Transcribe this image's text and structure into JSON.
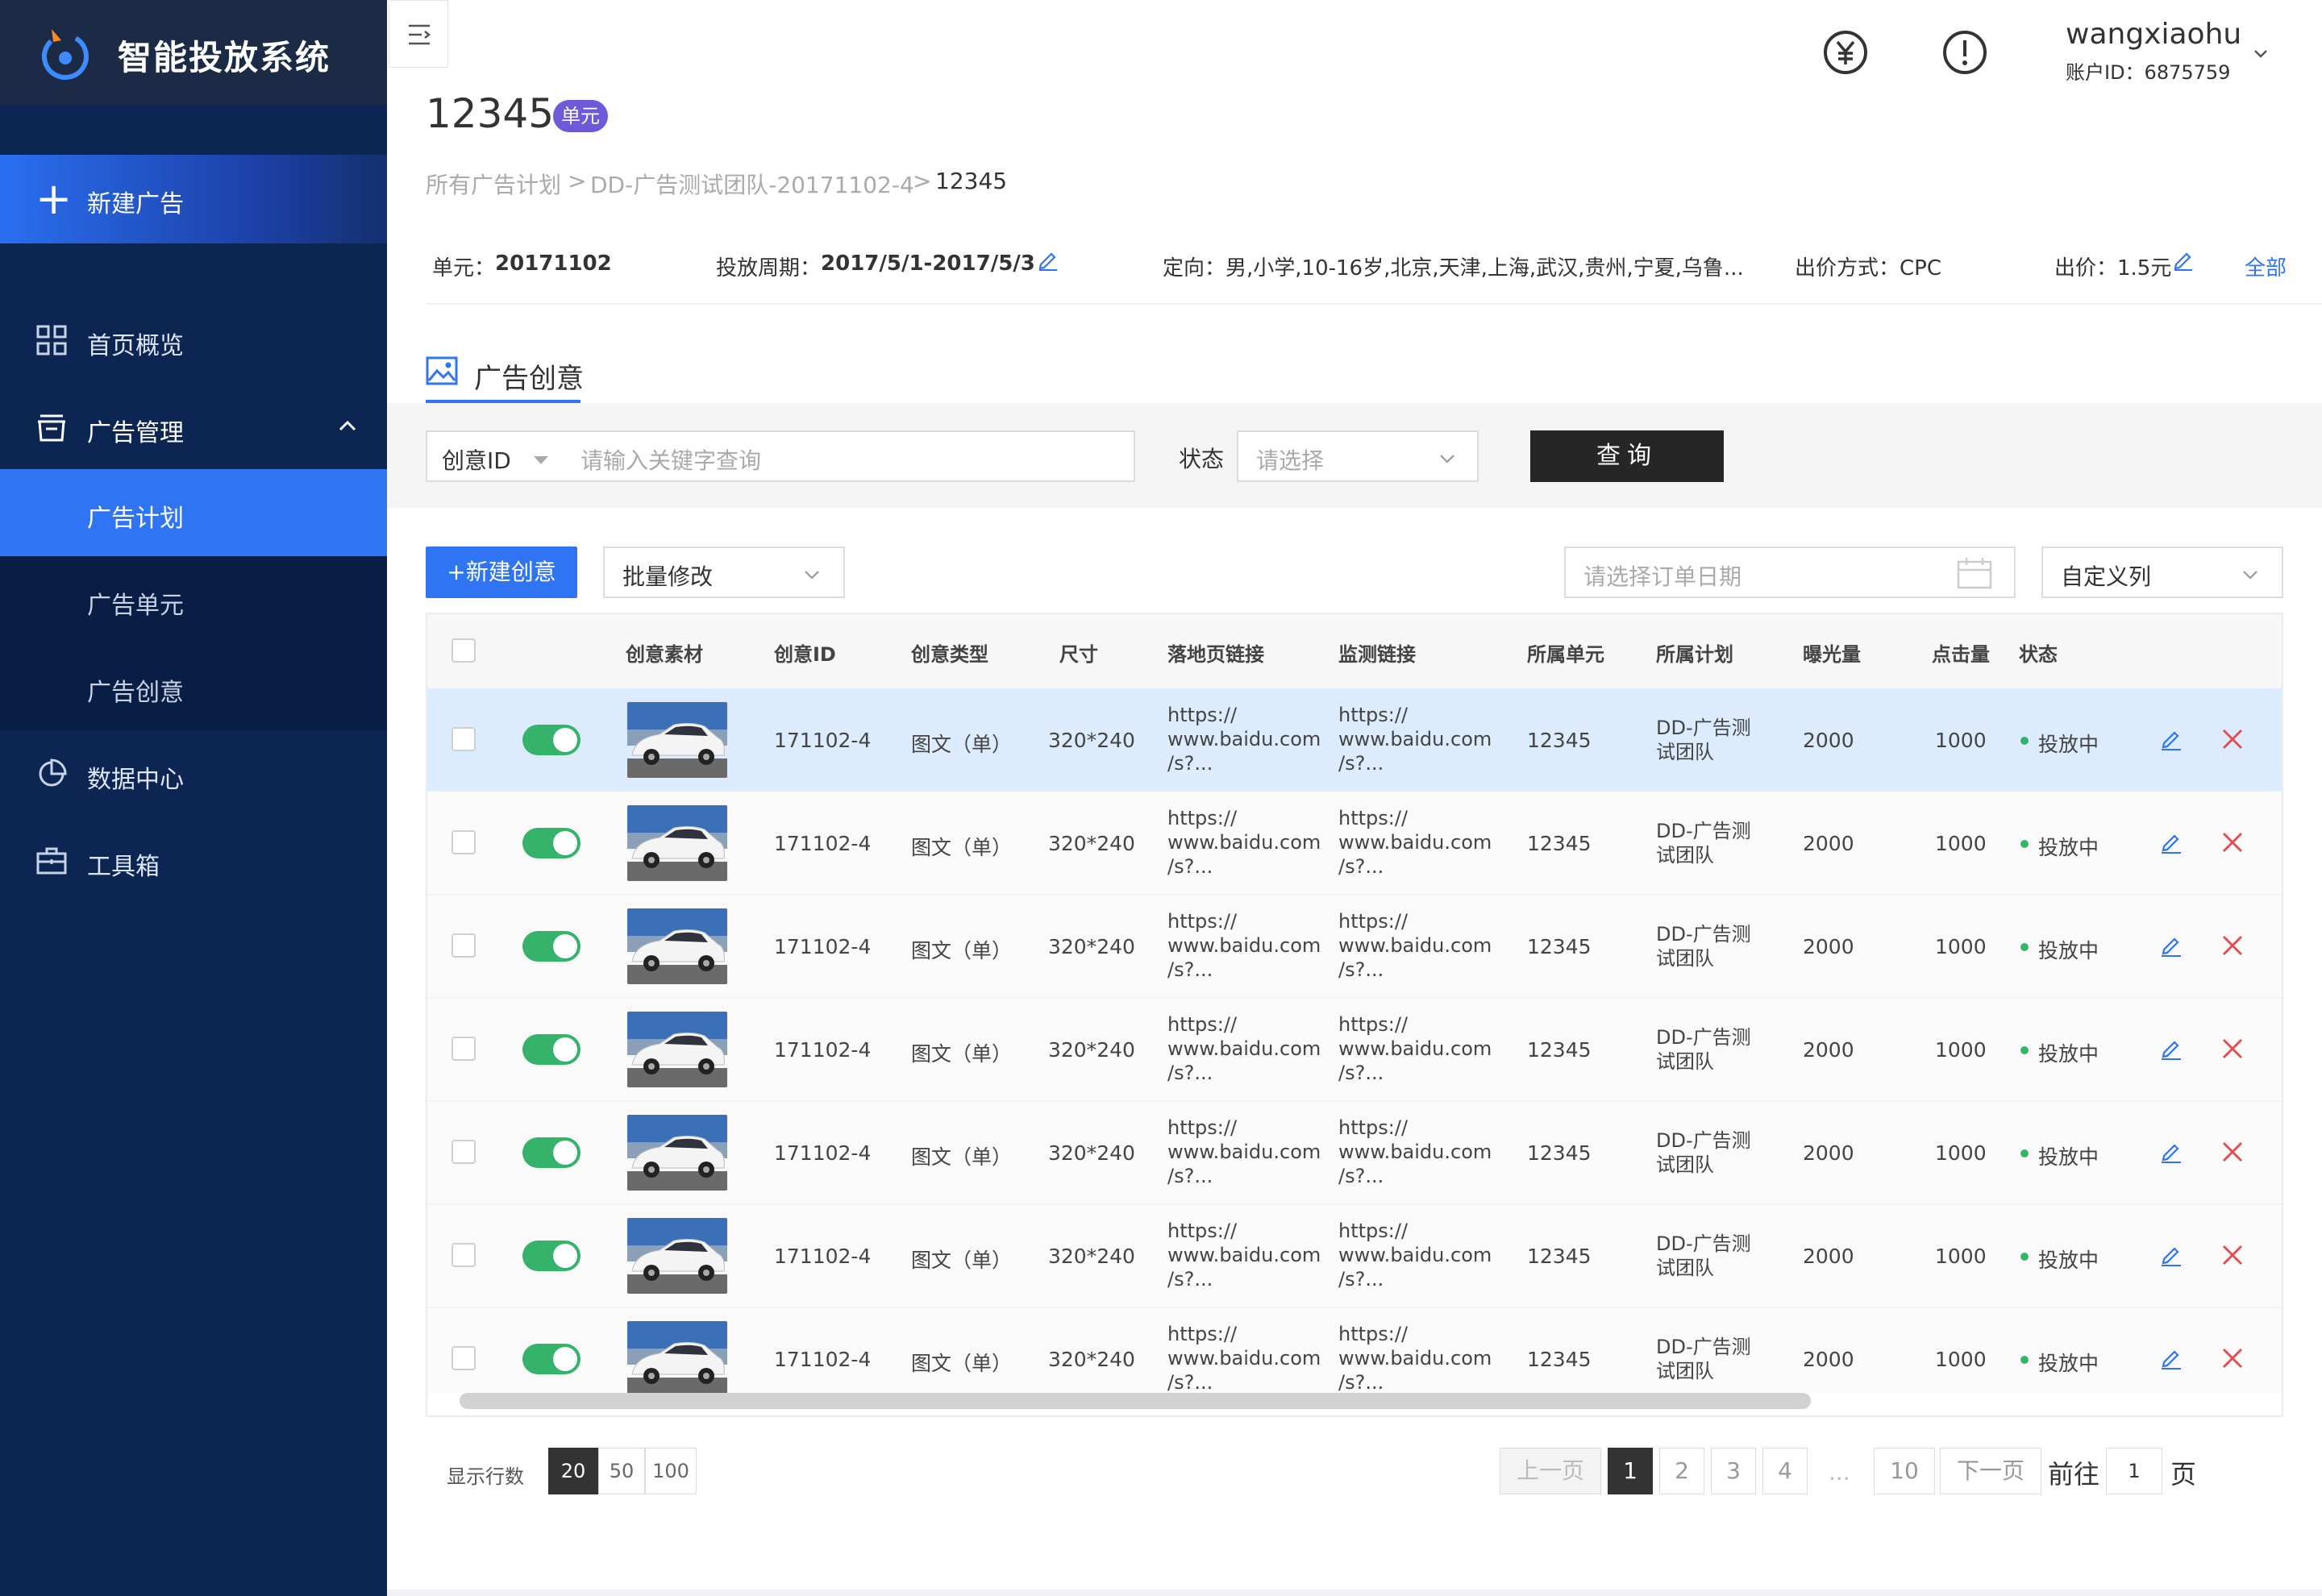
{
  "app": {
    "title": "智能投放系统"
  },
  "sidebar": {
    "new_ad": "新建广告",
    "items": [
      {
        "label": "首页概览",
        "icon": "grid-icon"
      },
      {
        "label": "广告管理",
        "icon": "inbox-icon"
      },
      {
        "label": "数据中心",
        "icon": "pie-chart-icon"
      },
      {
        "label": "工具箱",
        "icon": "toolbox-icon"
      }
    ],
    "sub_items": [
      {
        "label": "广告计划",
        "active": true
      },
      {
        "label": "广告单元",
        "active": false
      },
      {
        "label": "广告创意",
        "active": false
      }
    ]
  },
  "header": {
    "user_name": "wangxiaohu",
    "account_id": "账户ID：6875759"
  },
  "page": {
    "title": "12345",
    "badge": "单元",
    "breadcrumb": [
      "所有广告计划",
      ">",
      "DD-广告测试团队-20171102-4",
      ">",
      "12345"
    ]
  },
  "info": {
    "unit_label": "单元：",
    "unit_value": "20171102",
    "period_label": "投放周期：",
    "period_value": "2017/5/1-2017/5/3",
    "targeting": "定向：男,小学,10-16岁,北京,天津,上海,武汉,贵州,宁夏,乌鲁...",
    "bid_method": "出价方式：CPC",
    "bid": "出价：1.5元",
    "all_link": "全部"
  },
  "tab": {
    "label": "广告创意"
  },
  "filter": {
    "field": "创意ID",
    "placeholder": "请输入关键字查询",
    "status_label": "状态",
    "status_placeholder": "请选择",
    "query_label": "查询"
  },
  "toolbar": {
    "new_label": "+新建创意",
    "batch_label": "批量修改",
    "date_placeholder": "请选择订单日期",
    "columns_label": "自定义列"
  },
  "table": {
    "headers": [
      "创意素材",
      "创意ID",
      "创意类型",
      "尺寸",
      "落地页链接",
      "监测链接",
      "所属单元",
      "所属计划",
      "曝光量",
      "点击量",
      "状态"
    ],
    "rows": [
      {
        "id": "171102-4",
        "type": "图文（单）",
        "size": "320*240",
        "land": [
          "https://",
          "www.baidu.com",
          "/s?..."
        ],
        "monitor": [
          "https://",
          "www.baidu.com",
          "/s?..."
        ],
        "unit": "12345",
        "plan": [
          "DD-广告测",
          "试团队"
        ],
        "impressions": "2000",
        "clicks": "1000",
        "status": "投放中"
      },
      {
        "id": "171102-4",
        "type": "图文（单）",
        "size": "320*240",
        "land": [
          "https://",
          "www.baidu.com",
          "/s?..."
        ],
        "monitor": [
          "https://",
          "www.baidu.com",
          "/s?..."
        ],
        "unit": "12345",
        "plan": [
          "DD-广告测",
          "试团队"
        ],
        "impressions": "2000",
        "clicks": "1000",
        "status": "投放中"
      },
      {
        "id": "171102-4",
        "type": "图文（单）",
        "size": "320*240",
        "land": [
          "https://",
          "www.baidu.com",
          "/s?..."
        ],
        "monitor": [
          "https://",
          "www.baidu.com",
          "/s?..."
        ],
        "unit": "12345",
        "plan": [
          "DD-广告测",
          "试团队"
        ],
        "impressions": "2000",
        "clicks": "1000",
        "status": "投放中"
      },
      {
        "id": "171102-4",
        "type": "图文（单）",
        "size": "320*240",
        "land": [
          "https://",
          "www.baidu.com",
          "/s?..."
        ],
        "monitor": [
          "https://",
          "www.baidu.com",
          "/s?..."
        ],
        "unit": "12345",
        "plan": [
          "DD-广告测",
          "试团队"
        ],
        "impressions": "2000",
        "clicks": "1000",
        "status": "投放中"
      },
      {
        "id": "171102-4",
        "type": "图文（单）",
        "size": "320*240",
        "land": [
          "https://",
          "www.baidu.com",
          "/s?..."
        ],
        "monitor": [
          "https://",
          "www.baidu.com",
          "/s?..."
        ],
        "unit": "12345",
        "plan": [
          "DD-广告测",
          "试团队"
        ],
        "impressions": "2000",
        "clicks": "1000",
        "status": "投放中"
      },
      {
        "id": "171102-4",
        "type": "图文（单）",
        "size": "320*240",
        "land": [
          "https://",
          "www.baidu.com",
          "/s?..."
        ],
        "monitor": [
          "https://",
          "www.baidu.com",
          "/s?..."
        ],
        "unit": "12345",
        "plan": [
          "DD-广告测",
          "试团队"
        ],
        "impressions": "2000",
        "clicks": "1000",
        "status": "投放中"
      },
      {
        "id": "171102-4",
        "type": "图文（单）",
        "size": "320*240",
        "land": [
          "https://",
          "www.baidu.com",
          "/s?..."
        ],
        "monitor": [
          "https://",
          "www.baidu.com",
          "/s?..."
        ],
        "unit": "12345",
        "plan": [
          "DD-广告测",
          "试团队"
        ],
        "impressions": "2000",
        "clicks": "1000",
        "status": "投放中"
      }
    ]
  },
  "pagination": {
    "rows_label": "显示行数",
    "sizes": [
      "20",
      "50",
      "100"
    ],
    "prev": "上一页",
    "pages": [
      "1",
      "2",
      "3",
      "4"
    ],
    "ellipsis": "...",
    "last": "10",
    "next": "下一页",
    "goto_label": "前往",
    "goto_value": "1",
    "page_suffix": "页"
  },
  "colors": {
    "sidebar": "#0d2552",
    "accent": "#2f74f3",
    "active_status": "#36b36a",
    "delete": "#e84a4a",
    "badge": "#6f59d9"
  }
}
